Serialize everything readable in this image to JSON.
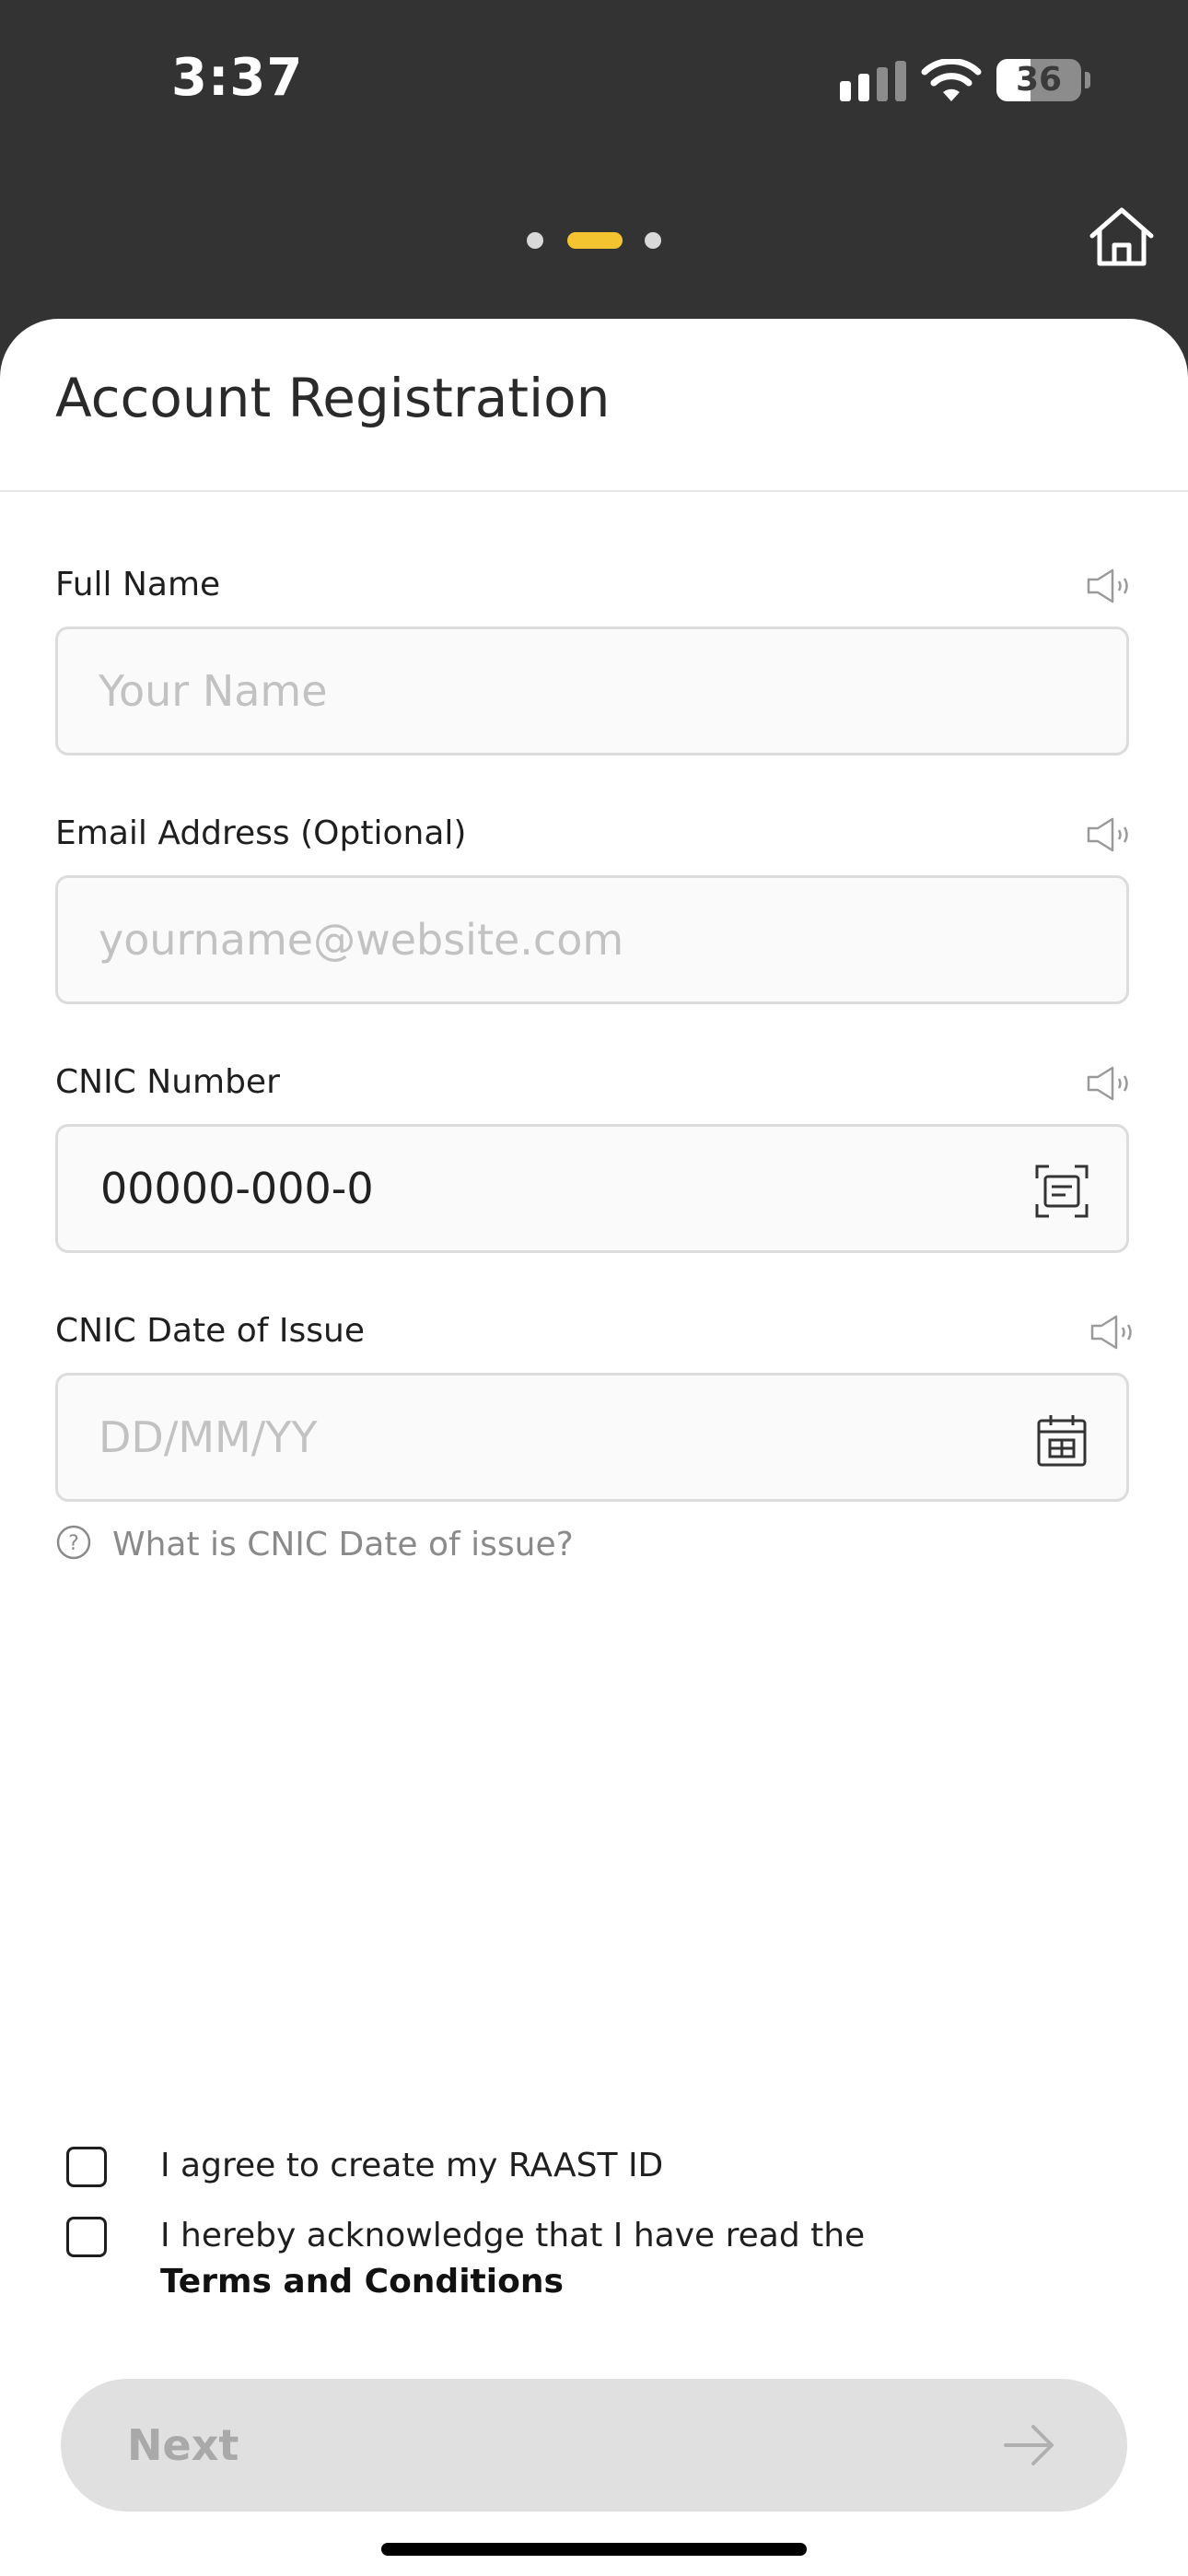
{
  "status_bar": {
    "time": "3:37",
    "battery": "36"
  },
  "header": {
    "title": "Account Registration",
    "steps": {
      "count": 3,
      "active": 2
    }
  },
  "form": {
    "full_name": {
      "label": "Full Name",
      "placeholder": "Your Name"
    },
    "email": {
      "label": "Email Address (Optional)",
      "placeholder": "yourname@website.com"
    },
    "cnic_number": {
      "label": "CNIC Number",
      "value": "00000-000-0"
    },
    "cnic_date": {
      "label": "CNIC Date of Issue",
      "placeholder": "DD/MM/YY",
      "help": "What is CNIC Date of issue?"
    }
  },
  "agreements": {
    "raast": "I agree to create my RAAST ID",
    "terms_prefix": "I hereby acknowledge that I have read the",
    "terms_link": "Terms and Conditions"
  },
  "next_button": {
    "label": "Next",
    "enabled": false
  },
  "colors": {
    "header_bg": "#333333",
    "accent": "#f4c430",
    "disabled_button": "#e0e0e0"
  },
  "icons": [
    "signal-icon",
    "wifi-icon",
    "battery-icon",
    "home-icon",
    "speaker-icon",
    "id-scan-icon",
    "calendar-icon",
    "question-icon",
    "arrow-right-icon"
  ]
}
